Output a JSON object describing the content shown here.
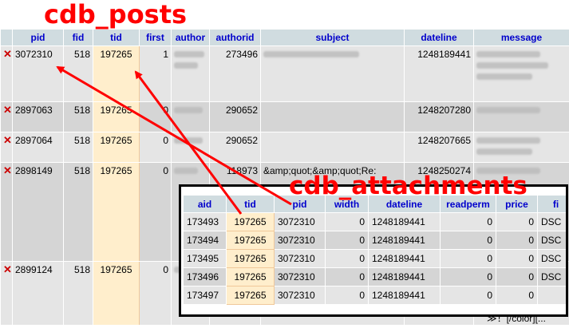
{
  "labels": {
    "posts_title": "cdb_posts",
    "attachments_title": "cdb_attachments"
  },
  "posts": {
    "headers": [
      "",
      "pid",
      "fid",
      "tid",
      "first",
      "author",
      "authorid",
      "subject",
      "dateline",
      "message"
    ],
    "rows": [
      {
        "pid": "3072310",
        "fid": "518",
        "tid": "197265",
        "first": "1",
        "authorid": "273496",
        "subject": "",
        "dateline": "1248189441"
      },
      {
        "pid": "2897063",
        "fid": "518",
        "tid": "197265",
        "first": "0",
        "authorid": "290652",
        "subject": "",
        "dateline": "1248207280"
      },
      {
        "pid": "2897064",
        "fid": "518",
        "tid": "197265",
        "first": "0",
        "authorid": "290652",
        "subject": "",
        "dateline": "1248207665"
      },
      {
        "pid": "2898149",
        "fid": "518",
        "tid": "197265",
        "first": "0",
        "authorid": "118973",
        "subject": "&amp;quot;&amp;quot;Re:",
        "dateline": "1248250274"
      },
      {
        "pid": "2899124",
        "fid": "518",
        "tid": "197265",
        "first": "0",
        "authorid": "",
        "subject": "",
        "dateline": ""
      }
    ],
    "footer_message": "≫！[/color][..."
  },
  "attachments": {
    "headers": [
      "aid",
      "tid",
      "pid",
      "width",
      "dateline",
      "readperm",
      "price",
      "fi"
    ],
    "rows": [
      {
        "aid": "173493",
        "tid": "197265",
        "pid": "3072310",
        "width": "0",
        "dateline": "1248189441",
        "readperm": "0",
        "price": "0",
        "fi": "DSC"
      },
      {
        "aid": "173494",
        "tid": "197265",
        "pid": "3072310",
        "width": "0",
        "dateline": "1248189441",
        "readperm": "0",
        "price": "0",
        "fi": "DSC"
      },
      {
        "aid": "173495",
        "tid": "197265",
        "pid": "3072310",
        "width": "0",
        "dateline": "1248189441",
        "readperm": "0",
        "price": "0",
        "fi": "DSC"
      },
      {
        "aid": "173496",
        "tid": "197265",
        "pid": "3072310",
        "width": "0",
        "dateline": "1248189441",
        "readperm": "0",
        "price": "0",
        "fi": "DSC"
      },
      {
        "aid": "173497",
        "tid": "197265",
        "pid": "3072310",
        "width": "0",
        "dateline": "1248189441",
        "readperm": "0",
        "price": "0",
        "fi": ""
      }
    ]
  },
  "colors": {
    "annotation": "#ff0000",
    "header_text": "#0000cc",
    "header_bg": "#d0dce0",
    "tid_highlight": "#ffeecc"
  }
}
